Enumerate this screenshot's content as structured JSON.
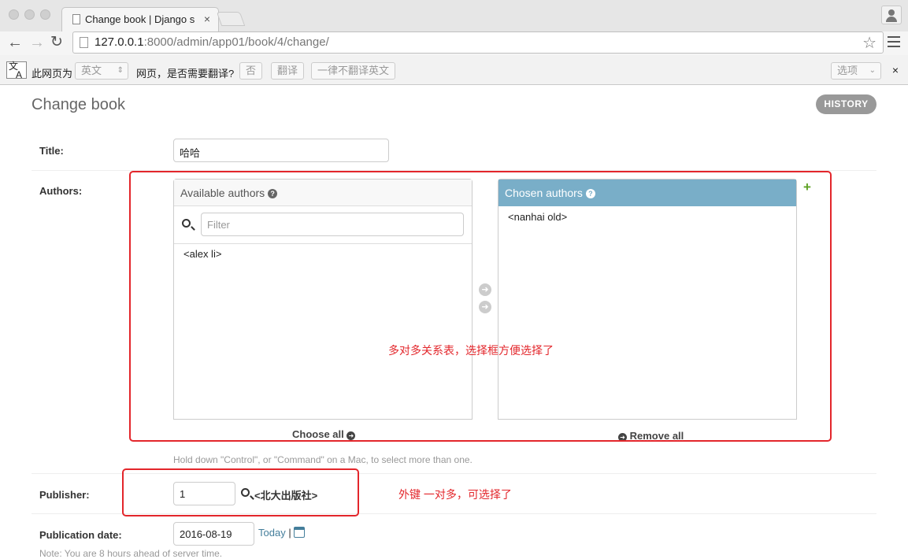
{
  "browser": {
    "tab_title": "Change book | Django site",
    "tab_close": "×",
    "url_host": "127.0.0.1",
    "url_rest": ":8000/admin/app01/book/4/change/"
  },
  "translate_bar": {
    "icon_text_top": "文",
    "icon_text_bottom": "A",
    "prefix": "此网页为",
    "language": "英文",
    "question": "网页，是否需要翻译?",
    "no_button": "否",
    "translate_button": "翻译",
    "never_button": "一律不翻译英文",
    "options_button": "选项",
    "close": "×"
  },
  "page": {
    "title": "Change book",
    "history_button": "HISTORY"
  },
  "form": {
    "title_label": "Title:",
    "title_value": "哈哈",
    "authors_label": "Authors:",
    "available_authors": {
      "header": "Available authors",
      "filter_placeholder": "Filter",
      "options": [
        "<alex li>"
      ],
      "choose_all": "Choose all"
    },
    "chosen_authors": {
      "header": "Chosen authors",
      "options": [
        "<nanhai old>"
      ],
      "remove_all": "Remove all"
    },
    "authors_help": "Hold down \"Control\", or \"Command\" on a Mac, to select more than one.",
    "publisher_label": "Publisher:",
    "publisher_value": "1",
    "publisher_name": "<北大出版社>",
    "publication_date_label": "Publication date:",
    "publication_date_value": "2016-08-19",
    "today_link": "Today",
    "separator": "|",
    "date_note": "Note: You are 8 hours ahead of server time."
  },
  "annotations": {
    "many_to_many": "多对多关系表，选择框方便选择了",
    "foreign_key": "外键 一对多，可选择了"
  },
  "colors": {
    "annotation": "#e3262b",
    "chosen_header": "#79aec8",
    "link": "#447e9b",
    "add_green": "#5fa225"
  }
}
